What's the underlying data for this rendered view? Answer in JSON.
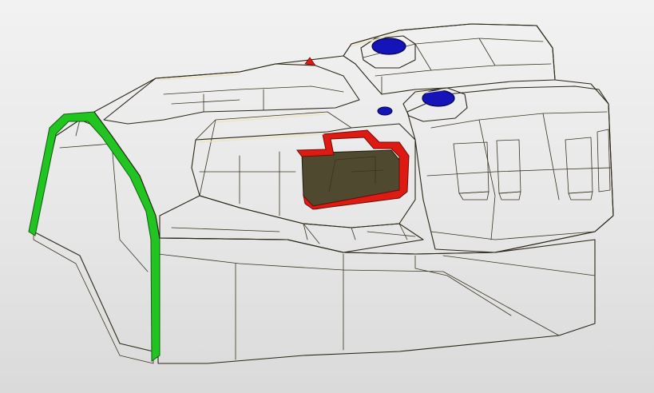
{
  "viewport": {
    "background_top": "#f2f2f2",
    "background_bottom": "#dadada"
  },
  "model": {
    "part_color_top": "#d8cc9b",
    "part_color_light": "#e3d9ae",
    "part_color_side": "#aea270",
    "part_color_shadow": "#8a8055",
    "part_color_inner": "#6f6743",
    "edge_color": "#2b2616",
    "highlight_green": "#22c422",
    "highlight_red": "#dd1b12",
    "highlight_blue": "#1414b8",
    "icons": [
      "blue-hole-marker",
      "red-cutout-highlight",
      "green-edge-highlight"
    ]
  }
}
